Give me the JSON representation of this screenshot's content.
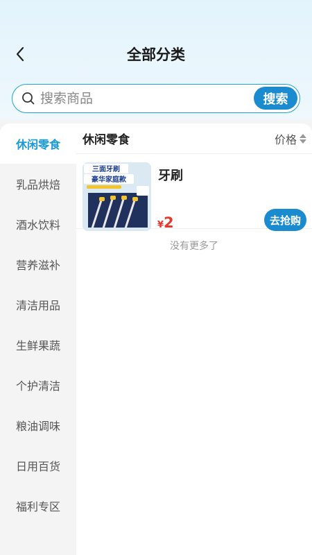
{
  "header": {
    "title": "全部分类"
  },
  "search": {
    "placeholder": "搜索商品",
    "button_label": "搜索"
  },
  "sidebar": {
    "items": [
      {
        "label": "休闲零食",
        "active": true
      },
      {
        "label": "乳品烘焙"
      },
      {
        "label": "酒水饮料"
      },
      {
        "label": "营养滋补"
      },
      {
        "label": "清洁用品"
      },
      {
        "label": "生鲜果蔬"
      },
      {
        "label": "个护清洁"
      },
      {
        "label": "粮油调味"
      },
      {
        "label": "日用百货"
      },
      {
        "label": "福利专区"
      }
    ]
  },
  "main": {
    "section_title": "休闲零食",
    "sort_label": "价格",
    "products": [
      {
        "name": "牙刷",
        "currency": "¥",
        "price": "2",
        "buy_label": "去抢购",
        "image_text": {
          "line1": "三面牙刷",
          "line2": "豪华家庭款"
        }
      }
    ],
    "end_text": "没有更多了"
  },
  "colors": {
    "accent": "#1b8bd0",
    "active_text": "#1a9bd6",
    "price": "#e8382c"
  }
}
